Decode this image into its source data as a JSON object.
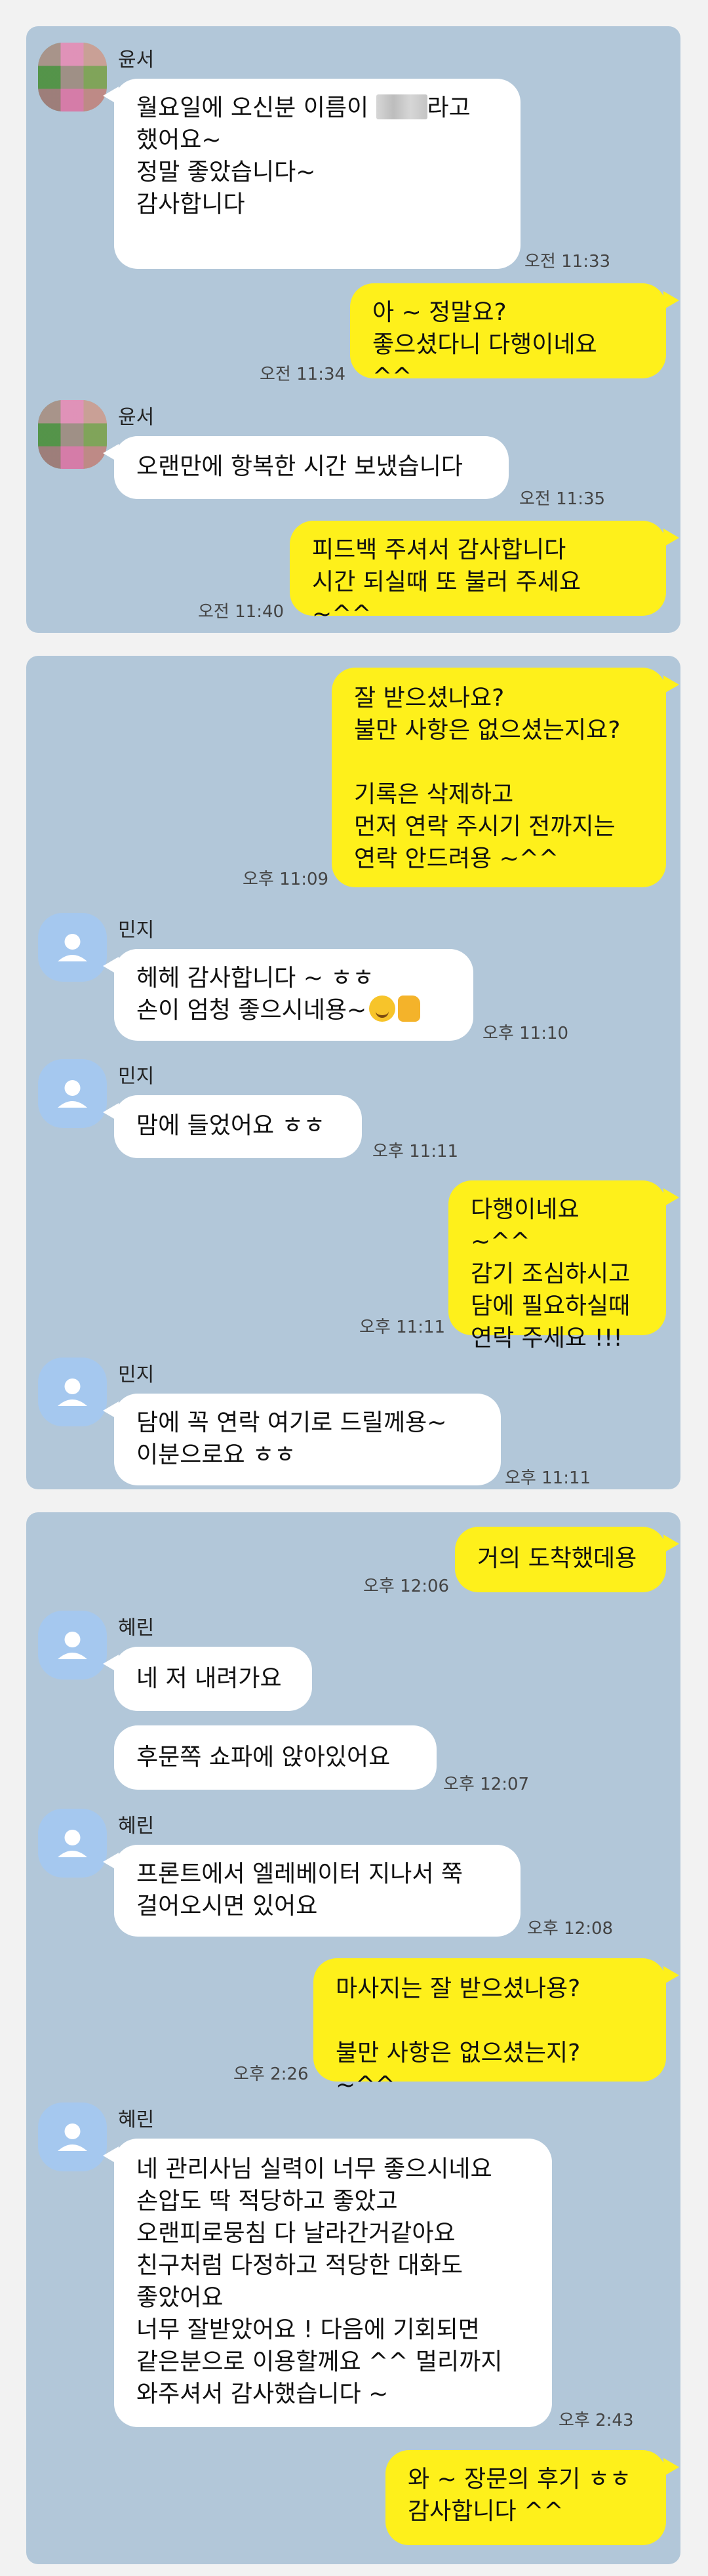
{
  "panel1": {
    "messages": [
      {
        "sender": "윤서",
        "line1_a": "월요일에 오신분 이름이 ",
        "line1_b": "라고",
        "rest": "했어요~\n정말 좋았습니다~\n감사합니다",
        "time": "오전 11:33"
      },
      {
        "text": "아 ~ 정말요?\n좋으셨다니 다행이네요 ^^",
        "time": "오전 11:34"
      },
      {
        "sender": "윤서",
        "text": "오랜만에 항복한 시간 보냈습니다",
        "time": "오전 11:35"
      },
      {
        "text": "피드백 주셔서 감사합니다\n시간 되실때 또 불러 주세요 ~^^",
        "time": "오전 11:40"
      }
    ]
  },
  "panel2": {
    "messages": [
      {
        "text": "잘 받으셨나요?\n불만 사항은 없으셨는지요?\n\n기록은 삭제하고\n먼저 연락 주시기 전까지는\n연락 안드려용 ~^^",
        "time": "오후 11:09"
      },
      {
        "sender": "민지",
        "line1": "헤헤 감사합니다 ~ ㅎㅎ",
        "line2": "손이 엄청 좋으시네용~",
        "time": "오후 11:10"
      },
      {
        "sender": "민지",
        "text": "맘에 들었어요 ㅎㅎ",
        "time": "오후 11:11"
      },
      {
        "text": "다행이네요 ~^^\n감기 조심하시고\n담에 필요하실때\n연락 주세요 !!!",
        "time": "오후 11:11"
      },
      {
        "sender": "민지",
        "text": "담에 꼭 연락 여기로 드릴께용~\n이분으로요 ㅎㅎ",
        "time": "오후 11:11"
      }
    ]
  },
  "panel3": {
    "messages": [
      {
        "text": "거의 도착했데용",
        "time": "오후 12:06"
      },
      {
        "sender": "혜린",
        "text": "네 저 내려가요"
      },
      {
        "text": "후문쪽 쇼파에 앉아있어요",
        "time": "오후 12:07"
      },
      {
        "sender": "혜린",
        "text": "프론트에서 엘레베이터 지나서 쭉\n걸어오시면 있어요",
        "time": "오후 12:08"
      },
      {
        "text": "마사지는 잘 받으셨나용?\n\n불만 사항은 없으셨는지? ~^^",
        "time": "오후 2:26"
      },
      {
        "sender": "혜린",
        "text": "네 관리사님 실력이 너무 좋으시네요\n손압도 딱 적당하고 좋았고\n오랜피로뭉침 다 날라간거같아요\n친구처럼 다정하고 적당한 대화도\n좋았어요\n너무 잘받았어요 ! 다음에 기회되면\n같은분으로 이용할께요 ^^ 멀리까지\n와주셔서 감사했습니다 ~",
        "time": "오후 2:43"
      },
      {
        "text": "와 ~ 장문의 후기 ㅎㅎ\n감사합니다 ^^"
      }
    ]
  },
  "colors": {
    "background": "#b2c7d9",
    "my_bubble": "#fef01b",
    "their_bubble": "#ffffff"
  }
}
